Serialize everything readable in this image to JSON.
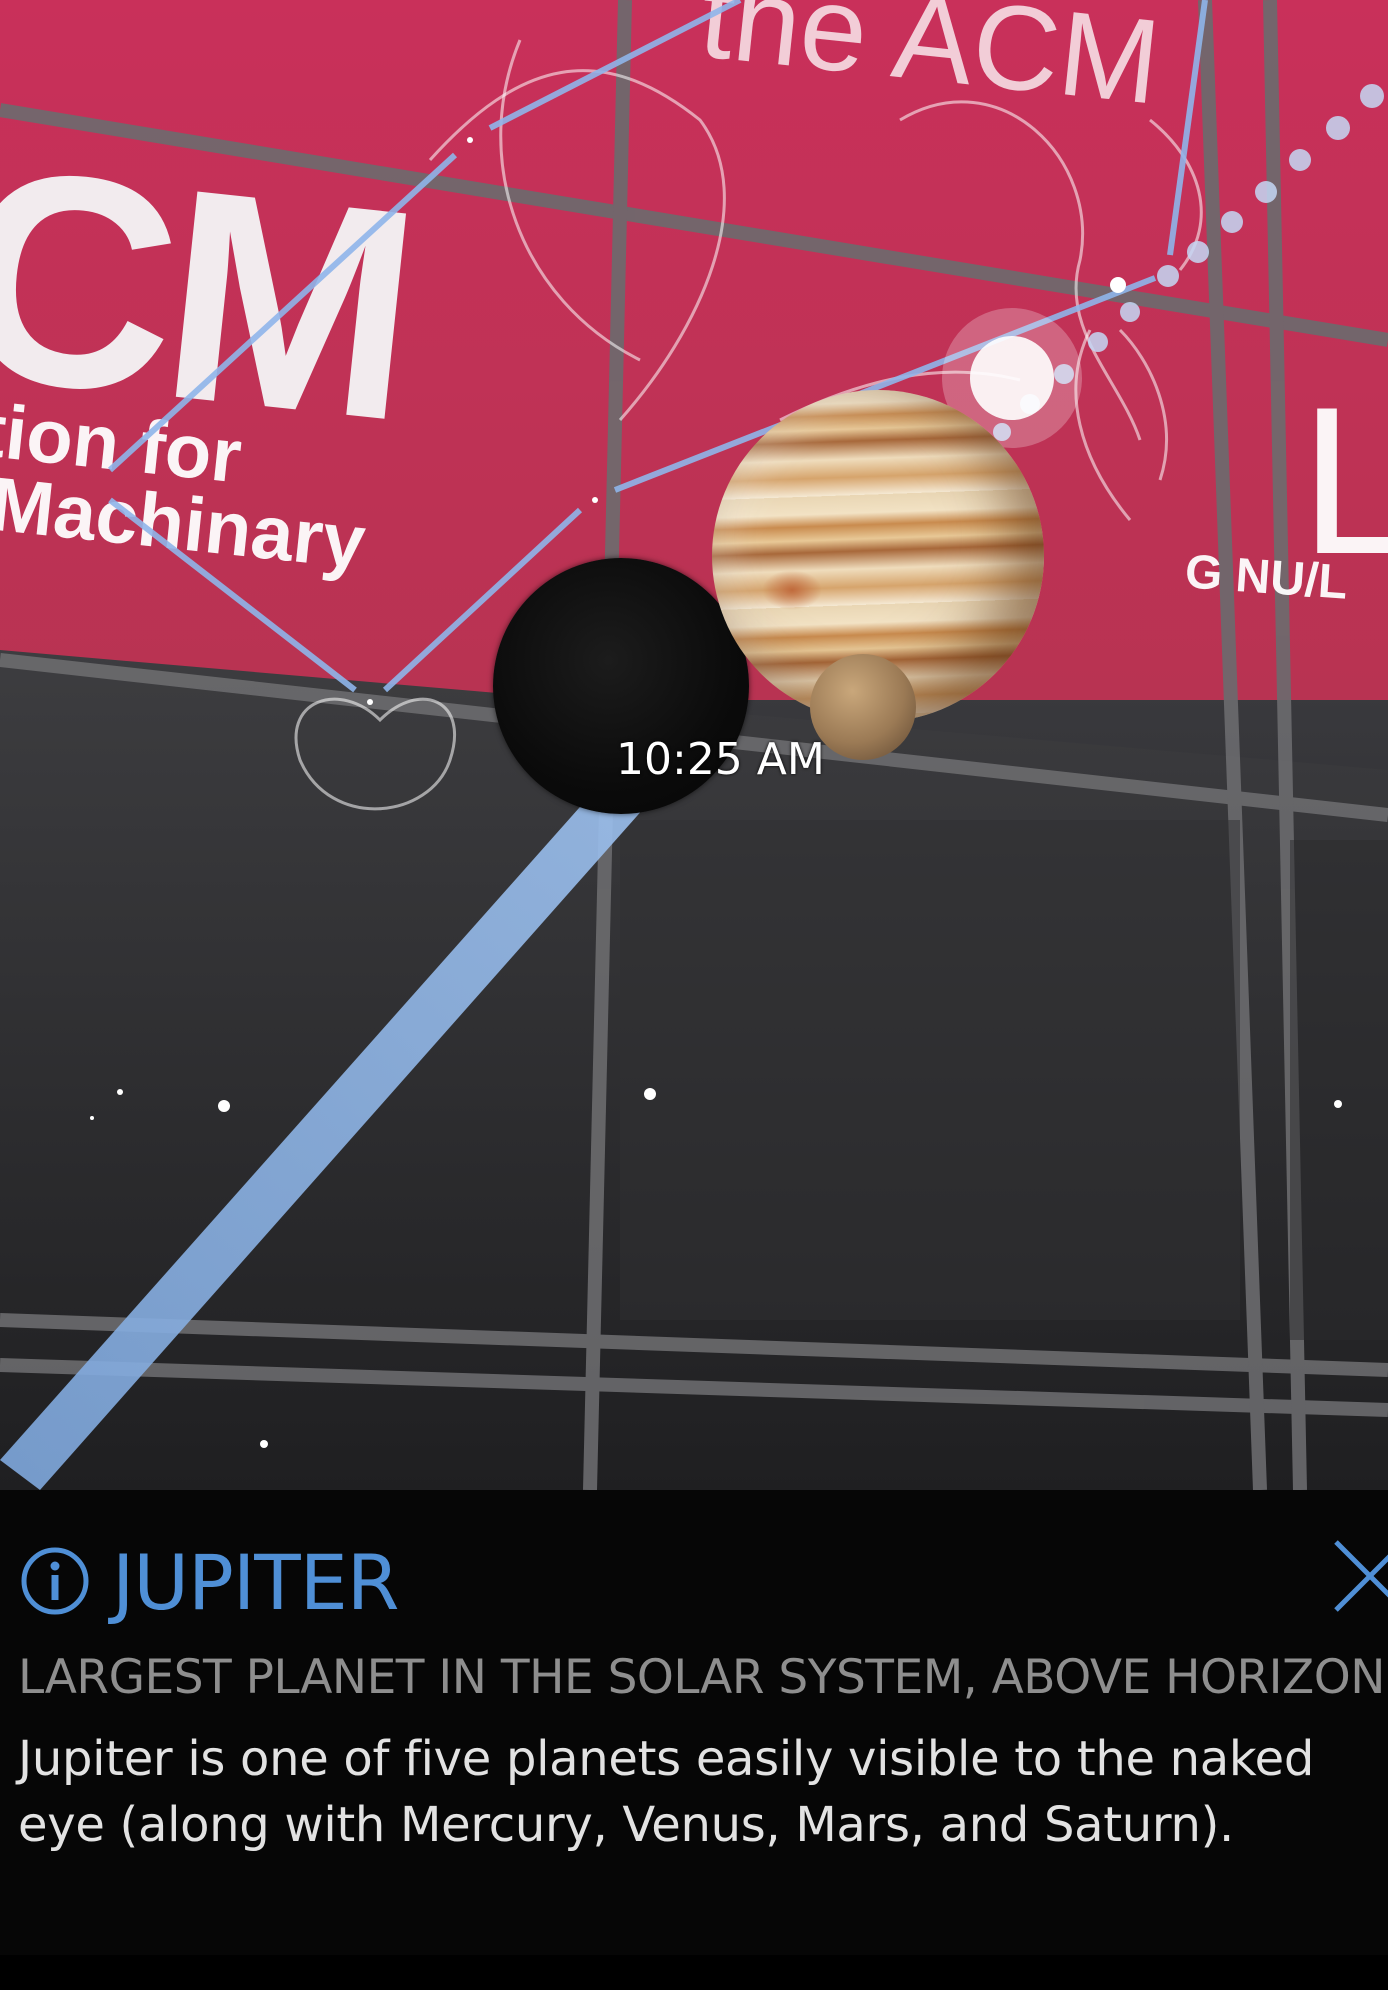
{
  "scene": {
    "background_text": {
      "logo": "CM",
      "top_text": "the ACM",
      "sub_line1": "tion for",
      "sub_line2": "Machinary",
      "right_letter": "L",
      "right_sub": "G  NU/L"
    },
    "time_label": "10:25 AM"
  },
  "info_panel": {
    "title": "JUPITER",
    "subtitle": "LARGEST PLANET IN THE SOLAR SYSTEM, ABOVE HORIZON",
    "description": "Jupiter is one of five planets easily visible to the naked eye (along with Mercury, Venus, Mars, and Saturn).",
    "info_icon": "info-circle-icon",
    "close_icon": "close-x-icon"
  },
  "colors": {
    "accent": "#4f8fd6",
    "panel_bg": "#060606",
    "subtitle": "#8e8e8e",
    "text": "#e2e2e2"
  }
}
